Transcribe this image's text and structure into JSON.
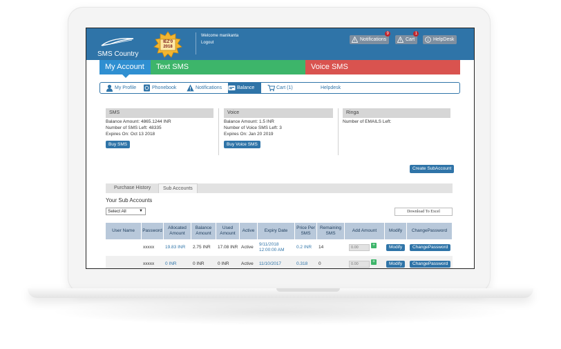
{
  "header": {
    "logo_text": "SMS Country",
    "award_text": "IEZ'0 2018",
    "welcome": "Welcome manikanta",
    "logout": "Logout",
    "notifications_label": "Notifications",
    "notifications_count": "9",
    "cart_label": "Cart",
    "cart_count": "1",
    "helpdesk_label": "HelpDesk"
  },
  "tabs": {
    "my_account": "My Account",
    "text_sms": "Text SMS",
    "voice_sms": "Voice SMS"
  },
  "subnav": {
    "my_profile": "My Profile",
    "phonebook": "Phonebook",
    "notifications": "Notifications",
    "balance": "Balance",
    "cart": "Cart (1)",
    "helpdesk": "Helpdesk"
  },
  "sms_panel": {
    "title": "SMS",
    "balance_amount": "Balance Amount:  4865.1244  INR",
    "sms_left": "Number of SMS Left:  48335",
    "expires": "Expires On:   Oct 13 2018",
    "button": "Buy SMS"
  },
  "voice_panel": {
    "title": "Voice",
    "balance_amount": "Balance Amount:  1.5  INR",
    "voice_left": "Number of Voice SMS Left:  3",
    "expires": "Expires On:   Jan 20 2019",
    "button": "Buy Voice SMS"
  },
  "ringa_panel": {
    "title": "Ringa",
    "emails_left": "Number of EMAILS Left:"
  },
  "create_subaccount": "Create SubAccount",
  "history_tabs": {
    "purchase_history": "Purchase History",
    "sub_accounts": "Sub Accounts"
  },
  "sub_accounts": {
    "title": "Your Sub Accounts",
    "filter_selected": "Select All",
    "download": "Download To Excel"
  },
  "table": {
    "headers": [
      "User Name",
      "Password",
      "Allocated Amount",
      "Balance Amount",
      "Used Amount",
      "Active",
      "Expiry Date",
      "Price Per SMS",
      "Remaining SMS",
      "Add Amount",
      "Modify",
      "ChangePassword"
    ],
    "rows": [
      {
        "user_name": "",
        "password": "xxxxx",
        "allocated": "19.83 INR",
        "balance": "2.75 INR",
        "used": "17.08 INR",
        "active": "Active",
        "expiry": "9/11/2018 12:00:00 AM",
        "price": "0.2 INR",
        "remaining": "14",
        "add_placeholder": "0.00",
        "modify": "Modify",
        "change_password": "ChangePassword"
      },
      {
        "user_name": "",
        "password": "xxxxx",
        "allocated": "0 INR",
        "balance": "0 INR",
        "used": "0 INR",
        "active": "Active",
        "expiry": "11/10/2017",
        "price": "0.318",
        "remaining": "0",
        "add_placeholder": "0.00",
        "modify": "Modify",
        "change_password": "ChangePassword"
      }
    ]
  },
  "colors": {
    "header_blue": "#2f74a8",
    "tab_green": "#3db56a",
    "tab_red": "#d9534f",
    "table_header": "#b8c8da"
  }
}
